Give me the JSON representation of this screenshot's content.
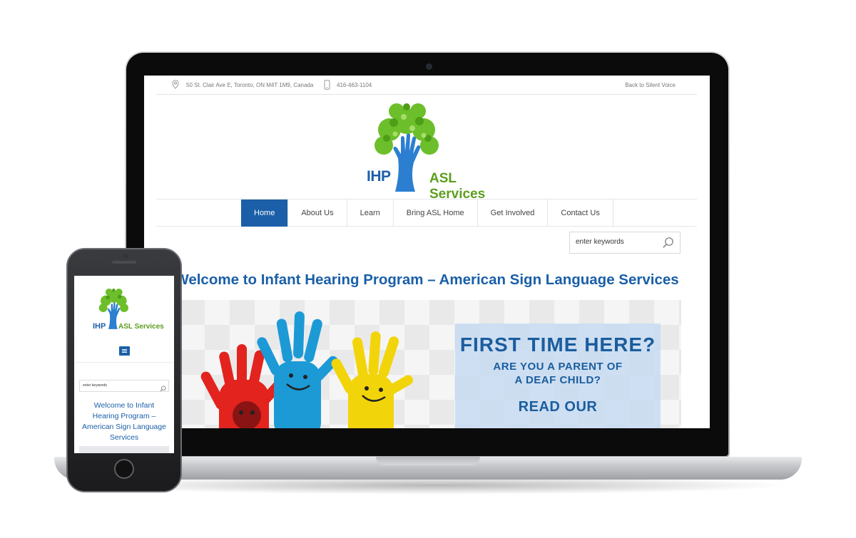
{
  "desktop": {
    "topbar": {
      "address": "50 St. Clair Ave E, Toronto, ON M4T 1M9, Canada",
      "phone": "416-463-1104",
      "back_link": "Back to Silent Voice"
    },
    "logo": {
      "left": "IHP",
      "right": "ASL Services"
    },
    "nav": {
      "items": [
        {
          "label": "Home"
        },
        {
          "label": "About Us"
        },
        {
          "label": "Learn"
        },
        {
          "label": "Bring ASL Home"
        },
        {
          "label": "Get Involved"
        },
        {
          "label": "Contact Us"
        }
      ]
    },
    "search": {
      "placeholder": "enter keywords"
    },
    "page_title": "Welcome to Infant Hearing Program – American Sign Language Services",
    "banner": {
      "headline": "FIRST TIME HERE?",
      "line1": "ARE YOU A PARENT OF",
      "line2": "A DEAF CHILD?",
      "cta": "READ OUR"
    }
  },
  "mobile": {
    "logo": {
      "left": "IHP",
      "right": "ASL Services"
    },
    "search": {
      "placeholder": "enter keywords"
    },
    "page_title": "Welcome to Infant Hearing Program – American Sign Language Services"
  },
  "colors": {
    "brand_blue": "#1a5fa8",
    "brand_green": "#5c9e1e",
    "promo_bg": "#c6dbf1"
  },
  "icons": [
    "map-pin-icon",
    "mobile-phone-icon",
    "search-icon",
    "menu-icon"
  ]
}
